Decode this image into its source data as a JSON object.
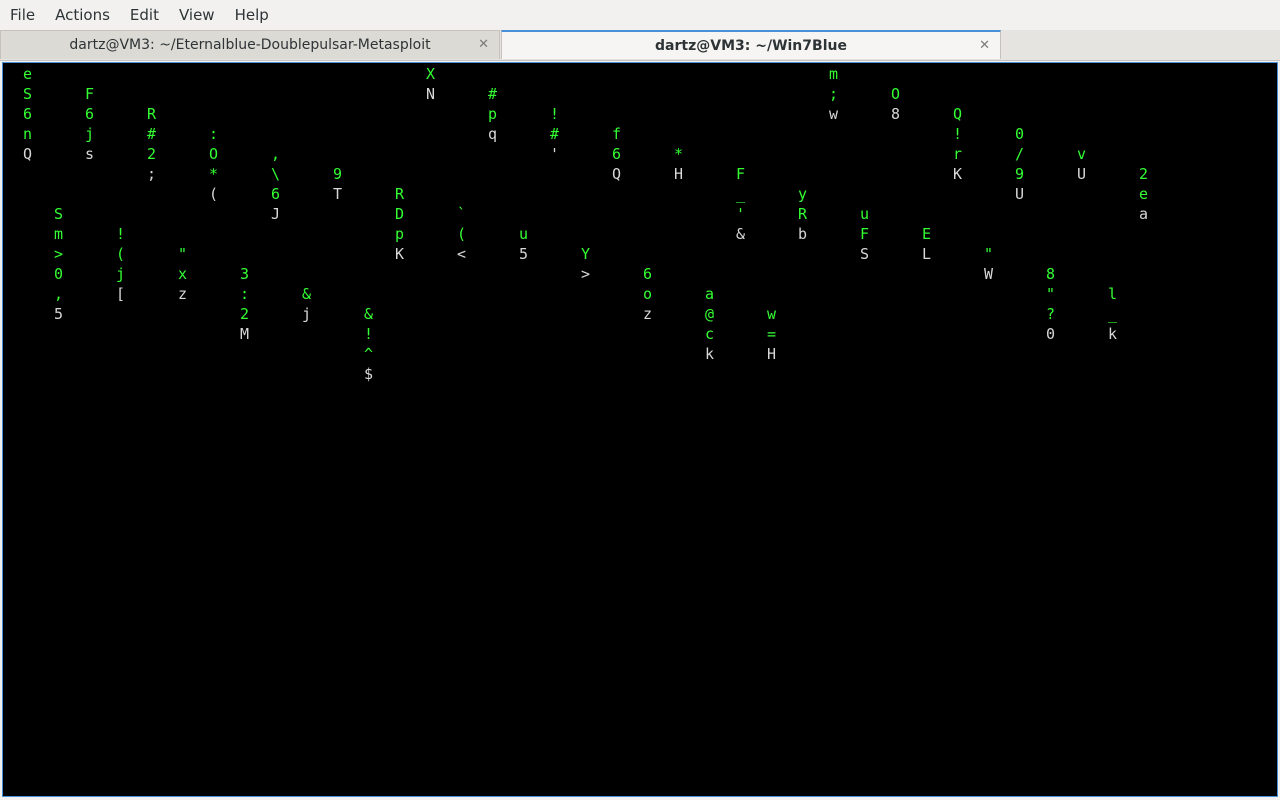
{
  "menu": [
    "File",
    "Actions",
    "Edit",
    "View",
    "Help"
  ],
  "tabs": [
    {
      "title": "dartz@VM3: ~/Eternalblue-Doublepulsar-Metasploit",
      "active": false
    },
    {
      "title": "dartz@VM3: ~/Win7Blue",
      "active": true
    }
  ],
  "tab_close_icon": "close-icon",
  "terminal": {
    "colors": {
      "green": "#33ff33",
      "white": "#d8d8d8",
      "background": "#000000"
    },
    "matrix_columns": [
      "eS6nQ",
      "Sm>0,5",
      "F6js",
      "!(j[",
      "R#2;",
      "\"xz",
      ":O*(",
      "3:2M",
      ",\\6J",
      "&j",
      "9T",
      "&!^$",
      "RDpK",
      "XN",
      "`(<",
      "#pq",
      "u5",
      "!#'",
      "Y>",
      "f6Q",
      "6oz",
      "*H",
      "a@ck",
      "F_'&",
      "w=H",
      "yRb",
      "m;w",
      "uFS",
      "O8",
      "EL",
      "Q!rK",
      "\"W",
      "0/9U",
      "8\"?0",
      "vU",
      "l_k",
      "2ea"
    ]
  }
}
